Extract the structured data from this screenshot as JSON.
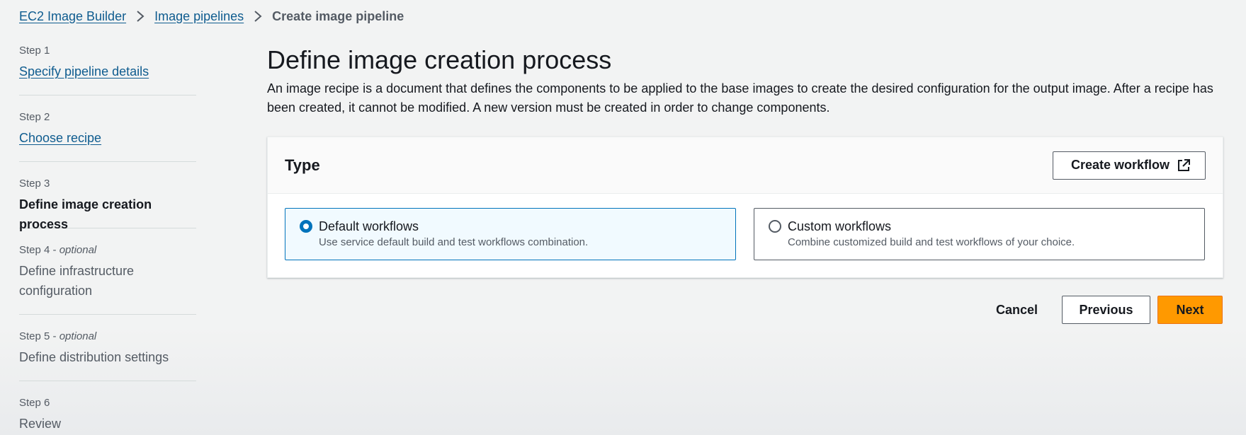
{
  "breadcrumb": {
    "items": [
      {
        "label": "EC2 Image Builder"
      },
      {
        "label": "Image pipelines"
      },
      {
        "label": "Create image pipeline"
      }
    ]
  },
  "steps": [
    {
      "step": "Step 1",
      "optional": "",
      "title": "Specify pipeline details",
      "state": "link"
    },
    {
      "step": "Step 2",
      "optional": "",
      "title": "Choose recipe",
      "state": "link"
    },
    {
      "step": "Step 3",
      "optional": "",
      "title": "Define image creation process",
      "state": "active"
    },
    {
      "step": "Step 4",
      "optional": "optional",
      "title": "Define infrastructure configuration",
      "state": "inactive"
    },
    {
      "step": "Step 5",
      "optional": "optional",
      "title": "Define distribution settings",
      "state": "inactive"
    },
    {
      "step": "Step 6",
      "optional": "",
      "title": "Review",
      "state": "inactive"
    }
  ],
  "step_optional_separator": " - ",
  "main": {
    "title": "Define image creation process",
    "description": "An image recipe is a document that defines the components to be applied to the base images to create the desired configuration for the output image. After a recipe has been created, it cannot be modified. A new version must be created in order to change components."
  },
  "card": {
    "title": "Type",
    "create_workflow_label": "Create workflow",
    "options": [
      {
        "title": "Default workflows",
        "description": "Use service default build and test workflows combination.",
        "selected": true
      },
      {
        "title": "Custom workflows",
        "description": "Combine customized build and test workflows of your choice.",
        "selected": false
      }
    ]
  },
  "actions": {
    "cancel": "Cancel",
    "previous": "Previous",
    "next": "Next"
  },
  "colors": {
    "link": "#0f5c8f",
    "primary": "#ff9900",
    "selected_border": "#0073bb",
    "selected_bg": "#f1faff"
  },
  "icons": {
    "separator": "chevron-right-icon",
    "external": "external-link-icon"
  }
}
